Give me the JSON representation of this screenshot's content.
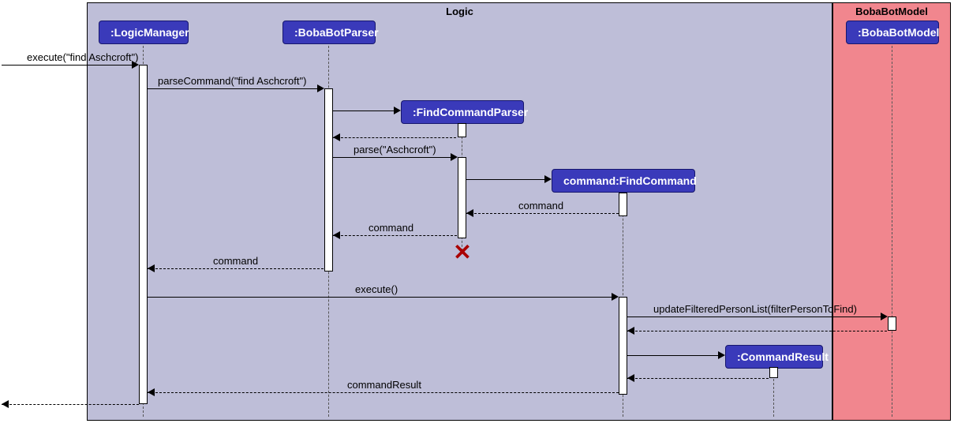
{
  "regions": {
    "logic": {
      "label": "Logic"
    },
    "model": {
      "label": "BobaBotModel"
    }
  },
  "participants": {
    "logicManager": {
      "label": ":LogicManager"
    },
    "bobaBotParser": {
      "label": ":BobaBotParser"
    },
    "findCommandParser": {
      "label": ":FindCommandParser"
    },
    "findCommand": {
      "label": "command:FindCommand"
    },
    "commandResult": {
      "label": ":CommandResult"
    },
    "bobaBotModel": {
      "label": ":BobaBotModel"
    }
  },
  "messages": {
    "m1": {
      "label": "execute(\"find Aschcroft\")"
    },
    "m2": {
      "label": "parseCommand(\"find Aschcroft\")"
    },
    "m3": {
      "label": ""
    },
    "m4": {
      "label": "parse(\"Aschcroft\")"
    },
    "m5": {
      "label": ""
    },
    "m6": {
      "label": "command"
    },
    "m7": {
      "label": "command"
    },
    "m8": {
      "label": "command"
    },
    "m9": {
      "label": "execute()"
    },
    "m10": {
      "label": "updateFilteredPersonList(filterPersonToFind)"
    },
    "m11": {
      "label": ""
    },
    "m12": {
      "label": ""
    },
    "m13": {
      "label": ""
    },
    "m14": {
      "label": "commandResult"
    },
    "m15": {
      "label": ""
    }
  }
}
